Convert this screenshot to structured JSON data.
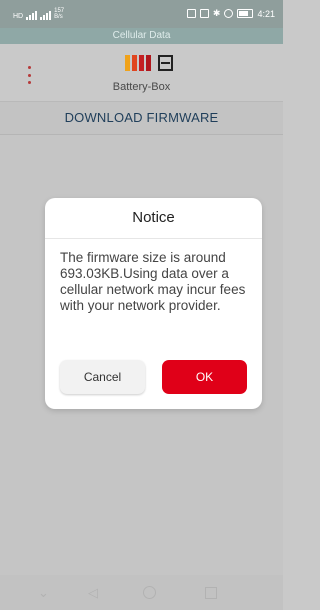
{
  "status_bar": {
    "carrier_small": "HD",
    "speed": "157",
    "speed_unit": "B/s",
    "time": "4:21"
  },
  "banner": {
    "text": "Cellular Data"
  },
  "app": {
    "title": "Battery-Box",
    "logo_colors": [
      "#f0a21a",
      "#e0451f",
      "#c41f22",
      "#b0171d"
    ],
    "menu_icon": "more-vertical-icon"
  },
  "download": {
    "label": "DOWNLOAD FIRMWARE"
  },
  "dialog": {
    "title": "Notice",
    "message": "The firmware size is around 693.03KB.Using data over a cellular network may incur fees with your network provider.",
    "cancel_label": "Cancel",
    "ok_label": "OK"
  },
  "colors": {
    "accent": "#e00018",
    "brand_text": "#1f3e5a"
  },
  "nav": {
    "icons": [
      "chevron-down-icon",
      "back-icon",
      "home-icon",
      "recent-apps-icon"
    ]
  }
}
